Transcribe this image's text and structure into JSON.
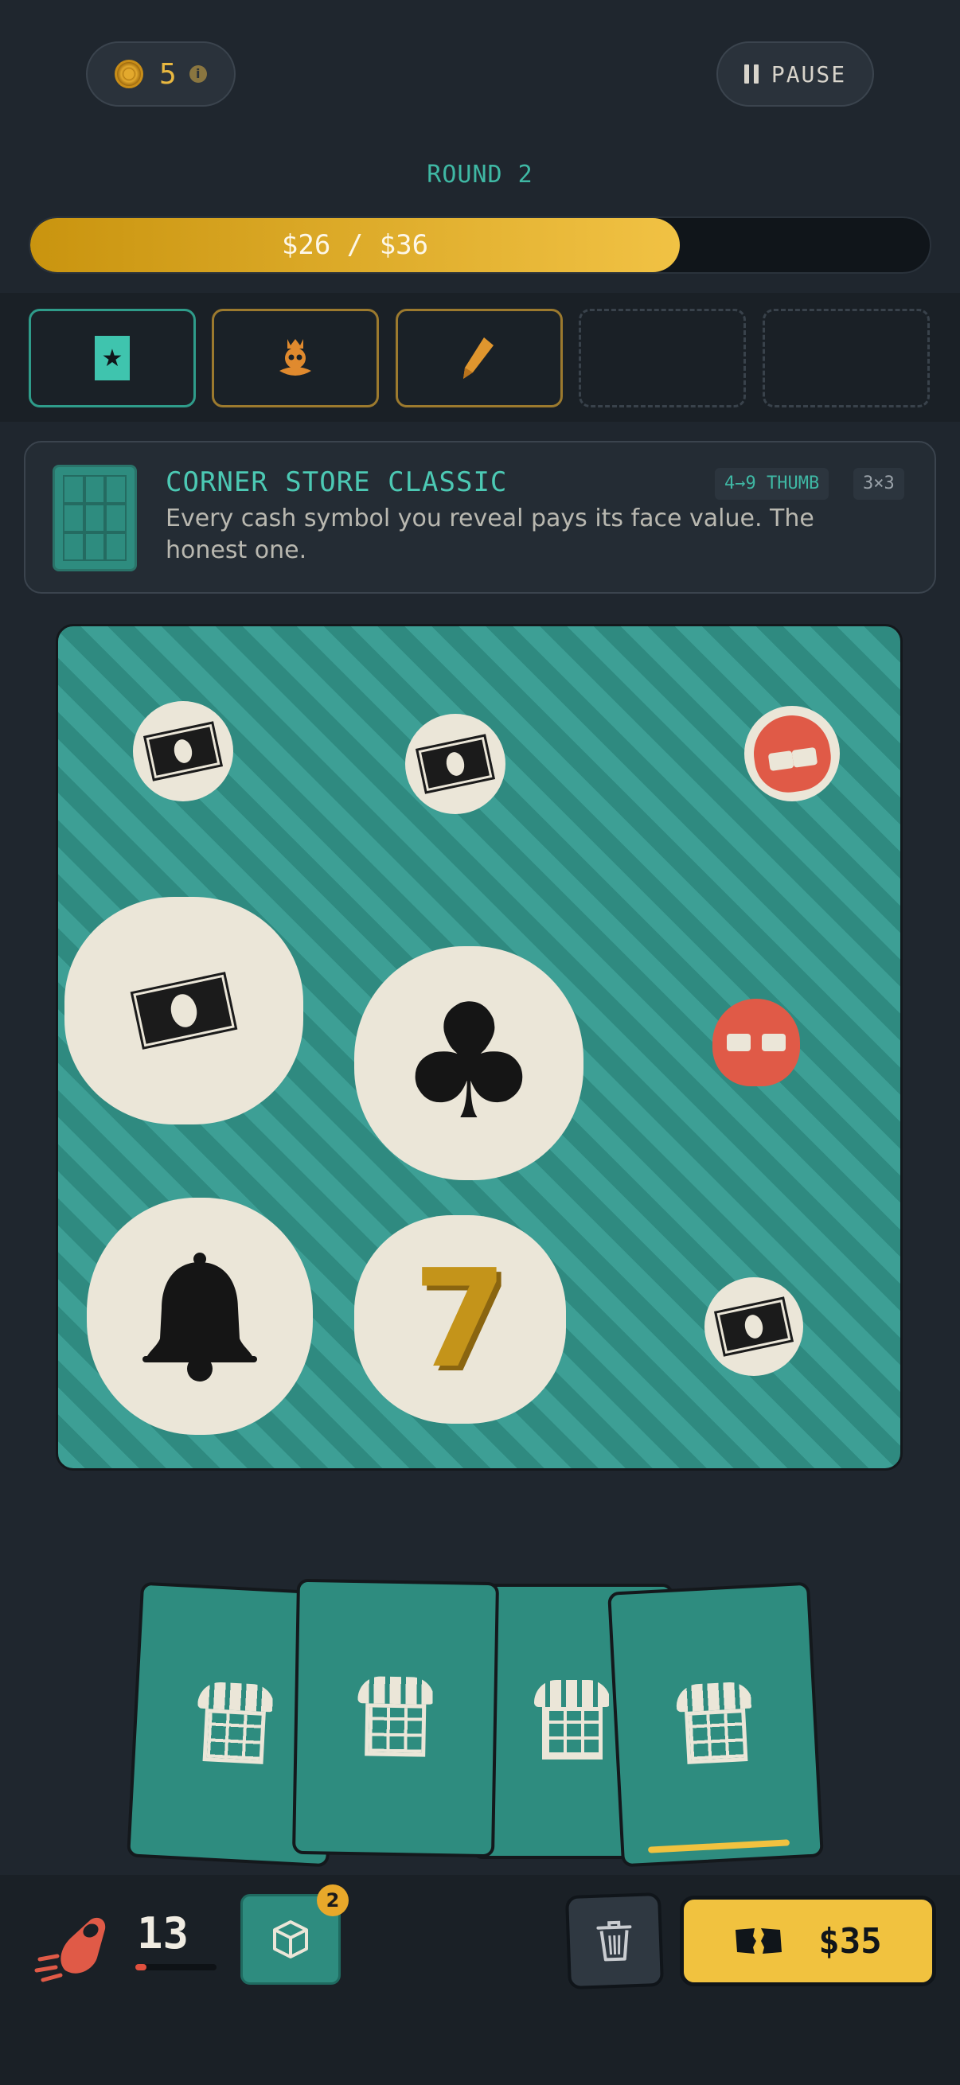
{
  "hud": {
    "coins": "5",
    "pause_label": "PAUSE",
    "round_label": "ROUND 2",
    "progress_text": "$26  /  $36",
    "progress_value": 26,
    "progress_target": 36
  },
  "slots": [
    {
      "state": "active",
      "icon": "star-badge-icon"
    },
    {
      "state": "filled",
      "icon": "crowned-skull-icon"
    },
    {
      "state": "filled",
      "icon": "pencil-icon"
    },
    {
      "state": "empty",
      "icon": ""
    },
    {
      "state": "empty",
      "icon": ""
    }
  ],
  "ticket": {
    "name": "CORNER STORE CLASSIC",
    "description": "Every cash symbol you reveal pays its face value. The honest one.",
    "tag_thumb": "4→9 THUMB",
    "tag_grid": "3×3"
  },
  "board": {
    "symbols": [
      "cash",
      "cash",
      "skull",
      "cash",
      "clover",
      "skull",
      "bell",
      "seven",
      "cash"
    ],
    "seven_glyph": "7"
  },
  "hand": {
    "cards": [
      "corner-store",
      "corner-store",
      "corner-store",
      "corner-store"
    ]
  },
  "footer": {
    "thumb_count": "13",
    "deck_badge": "2",
    "buy_price": "$35"
  },
  "colors": {
    "accent_teal": "#3fb8a4",
    "gold": "#f1c23f",
    "danger_red": "#e05a47",
    "background": "#1f262e"
  }
}
